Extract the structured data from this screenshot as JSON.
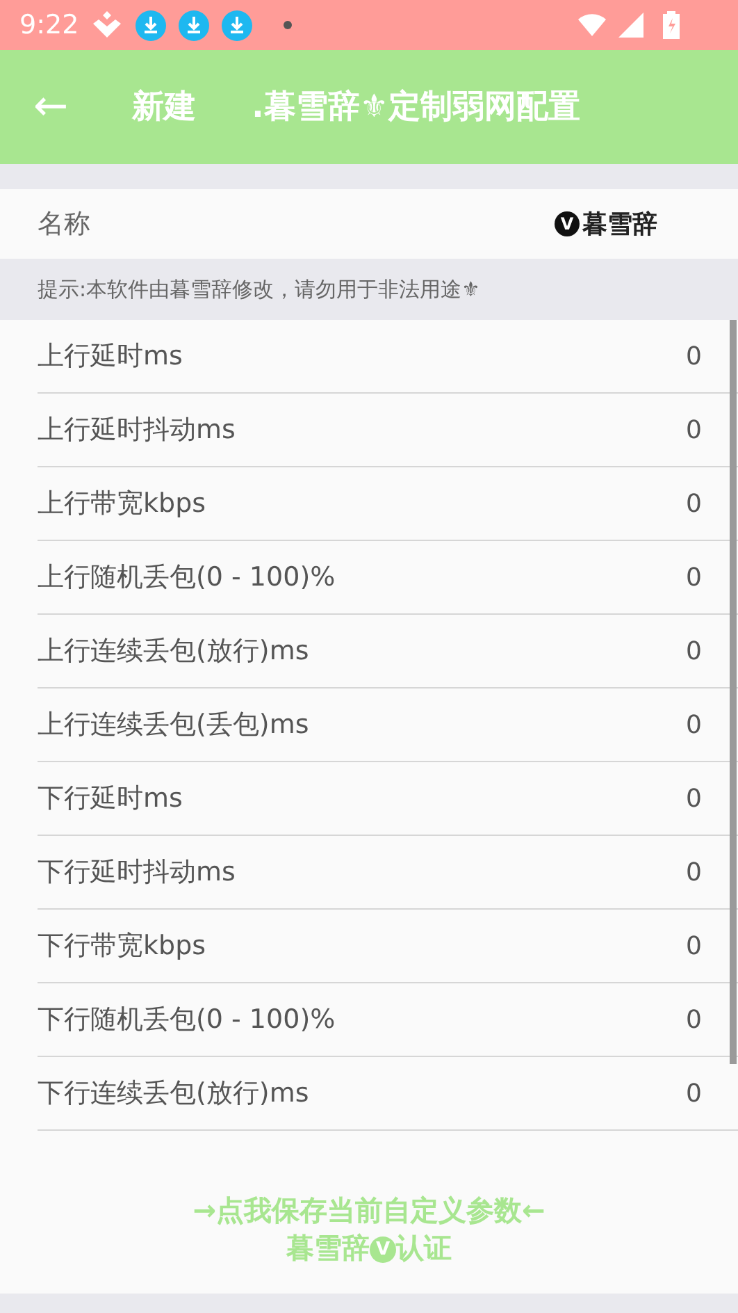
{
  "status_bar": {
    "time": "9:22"
  },
  "toolbar": {
    "back": "←",
    "action": "新建",
    "title": ".暮雪辞⚜定制弱网配置"
  },
  "name_row": {
    "label": "名称",
    "badge": "V",
    "value": "暮雪辞"
  },
  "hint": "提示:本软件由暮雪辞修改，请勿用于非法用途⚜",
  "settings": [
    {
      "label": "上行延时ms",
      "value": "0"
    },
    {
      "label": "上行延时抖动ms",
      "value": "0"
    },
    {
      "label": "上行带宽kbps",
      "value": "0"
    },
    {
      "label": "上行随机丢包(0 - 100)%",
      "value": "0"
    },
    {
      "label": "上行连续丢包(放行)ms",
      "value": "0"
    },
    {
      "label": "上行连续丢包(丢包)ms",
      "value": "0"
    },
    {
      "label": "下行延时ms",
      "value": "0"
    },
    {
      "label": "下行延时抖动ms",
      "value": "0"
    },
    {
      "label": "下行带宽kbps",
      "value": "0"
    },
    {
      "label": "下行随机丢包(0 - 100)%",
      "value": "0"
    },
    {
      "label": "下行连续丢包(放行)ms",
      "value": "0"
    }
  ],
  "footer": {
    "line1": "→点我保存当前自定义参数←",
    "line2_start": "暮雪辞",
    "badge": "V",
    "line2_end": "认证"
  }
}
